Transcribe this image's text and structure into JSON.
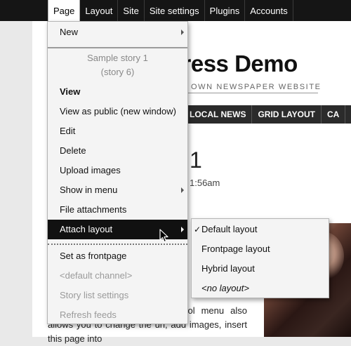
{
  "topbar": {
    "items": [
      {
        "label": "Page"
      },
      {
        "label": "Layout"
      },
      {
        "label": "Site"
      },
      {
        "label": "Site settings"
      },
      {
        "label": "Plugins"
      },
      {
        "label": "Accounts"
      }
    ]
  },
  "site": {
    "title_fragment": "xpress Demo",
    "tagline_fragment": "OWN NEWSPAPER WEBSITE",
    "nav": [
      {
        "label": "LOCAL NEWS"
      },
      {
        "label": "GRID LAYOUT"
      },
      {
        "label": "CA"
      }
    ],
    "story_title_fragment": "1",
    "story_time_fragment": "1:56am",
    "body_text": "in the control menu. The control menu also allows you to change the url, add images, insert this page into"
  },
  "page_menu": {
    "new_label": "New",
    "story_name": "Sample story 1",
    "story_id": "(story 6)",
    "items": [
      {
        "label": "View"
      },
      {
        "label": "View as public (new window)"
      },
      {
        "label": "Edit"
      },
      {
        "label": "Delete"
      },
      {
        "label": "Upload images"
      },
      {
        "label": "Show in menu"
      },
      {
        "label": "File attachments"
      },
      {
        "label": "Attach layout"
      }
    ],
    "lower_items": [
      {
        "label": "Set as frontpage"
      },
      {
        "label": "<default channel>"
      },
      {
        "label": "Story list settings"
      },
      {
        "label": "Refresh feeds"
      }
    ]
  },
  "layout_submenu": {
    "check_glyph": "✓",
    "items": [
      {
        "label": "Default layout",
        "checked": true
      },
      {
        "label": "Frontpage layout"
      },
      {
        "label": "Hybrid layout"
      },
      {
        "label": "<no layout>"
      }
    ]
  },
  "colors": {
    "topbar_bg": "#151515",
    "highlight_bg": "#111111",
    "menu_bg": "#f4f4f4",
    "disabled_text": "#9a9a9a"
  }
}
